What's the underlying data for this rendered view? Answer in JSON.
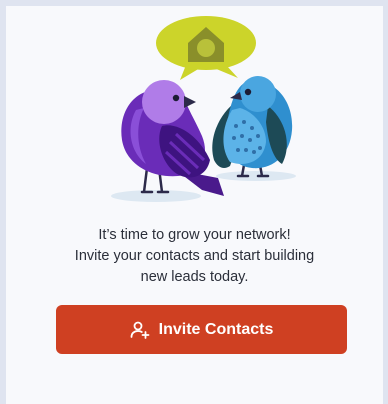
{
  "empty_state": {
    "message_line1": "It’s time to grow your network!",
    "message_line2": "Invite your contacts and start building",
    "message_line3": "new leads today."
  },
  "invite_button": {
    "label": "Invite Contacts",
    "icon": "add-user-icon",
    "color": "#cf4022"
  },
  "illustration": {
    "subject": "two-birds-with-home-speech-bubble"
  }
}
